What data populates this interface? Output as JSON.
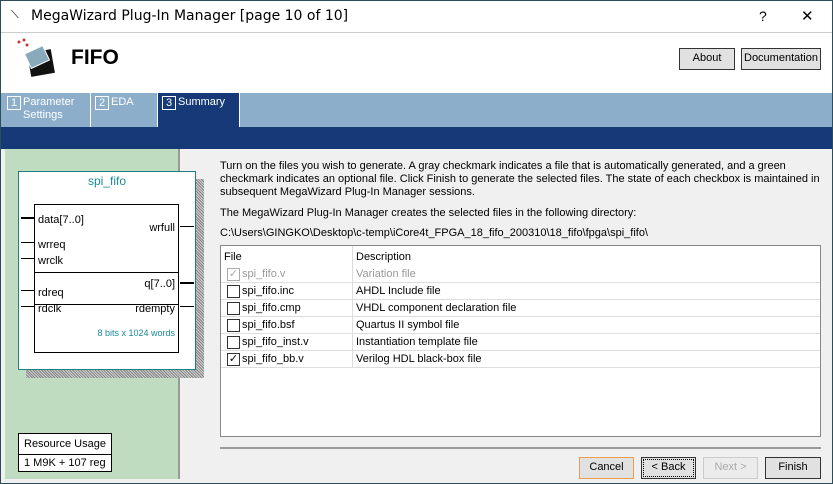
{
  "window": {
    "title": "MegaWizard Plug-In Manager [page 10 of 10]",
    "help": "?",
    "close": "✕"
  },
  "header": {
    "title": "FIFO",
    "about": "About",
    "documentation": "Documentation"
  },
  "tabs": [
    {
      "num": "1",
      "label": "Parameter Settings"
    },
    {
      "num": "2",
      "label": "EDA"
    },
    {
      "num": "3",
      "label": "Summary"
    }
  ],
  "symbol": {
    "name": "spi_fifo",
    "inputs": [
      "data[7..0]",
      "wrreq",
      "wrclk",
      "rdreq",
      "rdclk"
    ],
    "outputs": [
      "wrfull",
      "q[7..0]",
      "rdempty"
    ],
    "info": "8 bits x 1024 words"
  },
  "resource": {
    "title": "Resource Usage",
    "value": "1 M9K + 107 reg"
  },
  "description": "Turn on the files you wish to generate. A gray checkmark indicates a file that is automatically generated, and a green checkmark indicates an optional file. Click Finish to generate the selected files. The state of each checkbox is maintained in subsequent MegaWizard Plug-In Manager sessions.",
  "dir_label": "The MegaWizard Plug-In Manager creates the selected files in the following directory:",
  "dir_path": "C:\\Users\\GINGKO\\Desktop\\c-temp\\iCore4t_FPGA_18_fifo_200310\\18_fifo\\fpga\\spi_fifo\\",
  "table": {
    "headers": [
      "File",
      "Description"
    ],
    "rows": [
      {
        "file": "spi_fifo.v",
        "desc": "Variation file",
        "checked": true,
        "disabled": true
      },
      {
        "file": "spi_fifo.inc",
        "desc": "AHDL Include file",
        "checked": false,
        "disabled": false
      },
      {
        "file": "spi_fifo.cmp",
        "desc": "VHDL component declaration file",
        "checked": false,
        "disabled": false
      },
      {
        "file": "spi_fifo.bsf",
        "desc": "Quartus II symbol file",
        "checked": false,
        "disabled": false
      },
      {
        "file": "spi_fifo_inst.v",
        "desc": "Instantiation template file",
        "checked": false,
        "disabled": false
      },
      {
        "file": "spi_fifo_bb.v",
        "desc": "Verilog HDL black-box file",
        "checked": true,
        "disabled": false
      }
    ]
  },
  "buttons": {
    "cancel": "Cancel",
    "back": "< Back",
    "next": "Next >",
    "finish": "Finish"
  }
}
